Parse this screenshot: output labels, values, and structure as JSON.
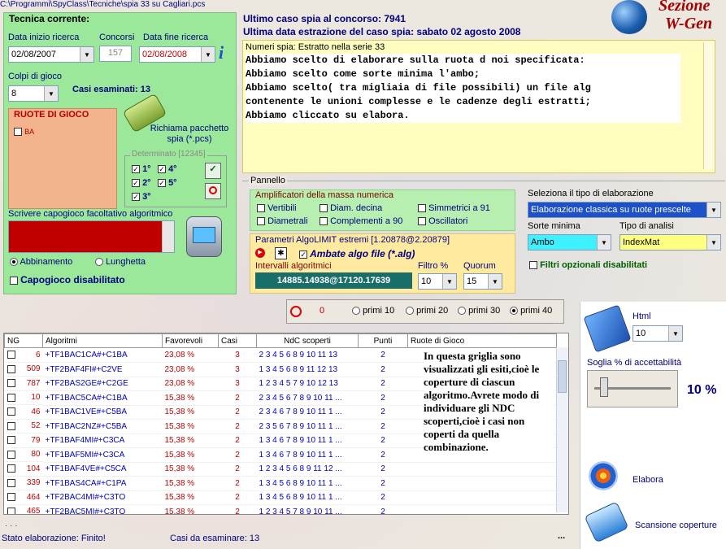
{
  "path": "C:\\Programmi\\SpyClass\\Tecniche\\spia 33 su Cagliari.pcs",
  "brand": {
    "line1": "Sezione",
    "line2": "W-Gen"
  },
  "tecnica": {
    "title": "Tecnica corrente:",
    "data_inizio_label": "Data inizio ricerca",
    "data_inizio_value": "02/08/2007",
    "concorsi_label": "Concorsi",
    "concorsi_value": "157",
    "data_fine_label": "Data fine ricerca",
    "data_fine_value": "02/08/2008",
    "colpi_label": "Colpi di gioco",
    "colpi_value": "8",
    "casi_label": "Casi esaminati: 13",
    "ruote_title": "RUOTE DI GIOCO",
    "ruote_items": [
      "BA"
    ],
    "richiama_label": "Richiama pacchetto spia (*.pcs)",
    "determinato_label": "Determinato [12345]",
    "det": [
      "1°",
      "2°",
      "3°",
      "4°",
      "5°"
    ],
    "capogioco_label": "Scrivere capogioco facoltativo algoritmico",
    "radio_abbinamento": "Abbinamento",
    "radio_lunghetta": "Lunghetta",
    "capogioco_disabled": "Capogioco disabilitato"
  },
  "header_info": {
    "ultimo": "Ultimo caso spia al concorso: 7941",
    "ultima_data": "Ultima data estrazione del caso spia: sabato 02 agosto 2008"
  },
  "notes": {
    "title": "Numeri spia: Estratto nella serie 33",
    "lines": [
      "Abbiamo scelto di elaborare sulla ruota d noi specificata:",
      "Abbiamo scelto come sorte minima l'ambo;",
      "Abbiamo scelto( tra migliaia di file possibili) un file alg",
      "contenente le unioni complesse e le cadenze degli estratti;",
      "Abbiamo cliccato su elabora."
    ]
  },
  "pannello": {
    "title": "Pannello",
    "ampl_title": "Amplificatori della massa numerica",
    "ampl": [
      "Vertibili",
      "Diam. decina",
      "Simmetrici a 91",
      "Diametrali",
      "Complementi a 90",
      "Oscillatori"
    ],
    "param_title": "Parametri AlgoLIMIT estremi [1.20878@2.20879]",
    "ambate_label": "Ambate algo file (*.alg)",
    "intervalli_label": "Intervalli algoritmici",
    "intervalli_value": "14885.14938@17120.17639",
    "filtro_label": "Filtro %",
    "filtro_value": "10",
    "quorum_label": "Quorum",
    "quorum_value": "15",
    "tipo_label": "Seleziona il tipo di elaborazione",
    "tipo_value": "Elaborazione classica su ruote prescelte",
    "sorte_label": "Sorte minima",
    "sorte_value": "Ambo",
    "analisi_label": "Tipo di analisi",
    "analisi_value": "IndexMat",
    "filtri_label": "Filtri opzionali disabilitati"
  },
  "primi": {
    "count": "0",
    "options": [
      "primi 10",
      "primi 20",
      "primi 30",
      "primi 40"
    ],
    "selected": 3
  },
  "grid": {
    "headers": [
      "NG",
      "Algoritmi",
      "Favorevoli",
      "Casi",
      "NdC scoperti",
      "Punti",
      "Ruote di Gioco"
    ],
    "rows": [
      [
        "6",
        "+TF1BAC1CA#+C1BA",
        "23,08 %",
        "3",
        "2 3 4 5 6 8 9 10 11 13",
        "2"
      ],
      [
        "509",
        "+TF2BAF4FI#+C2VE",
        "23,08 %",
        "3",
        "1 3 4 5 6 8 9 11 12 13",
        "2"
      ],
      [
        "787",
        "+TF2BAS2GE#+C2GE",
        "23,08 %",
        "3",
        "1 2 3 4 5 7 9 10 12 13",
        "2"
      ],
      [
        "10",
        "+TF1BAC5CA#+C1BA",
        "15,38 %",
        "2",
        "2 3 4 5 6 7 8 9 10 11 ...",
        "2"
      ],
      [
        "46",
        "+TF1BAC1VE#+C5BA",
        "15,38 %",
        "2",
        "2 3 4 6 7 8 9 10 11 1 ...",
        "2"
      ],
      [
        "52",
        "+TF1BAC2NZ#+C5BA",
        "15,38 %",
        "2",
        "2 3 5 6 7 8 9 10 11 1 ...",
        "2"
      ],
      [
        "79",
        "+TF1BAF4MI#+C3CA",
        "15,38 %",
        "2",
        "1 3 4 6 7 8 9 10 11 1 ...",
        "2"
      ],
      [
        "80",
        "+TF1BAF5MI#+C3CA",
        "15,38 %",
        "2",
        "1 3 4 6 7 8 9 10 11 1 ...",
        "2"
      ],
      [
        "104",
        "+TF1BAF4VE#+C5CA",
        "15,38 %",
        "2",
        "1 2 3 4 5 6 8 9 11 12 ...",
        "2"
      ],
      [
        "339",
        "+TF1BAS4CA#+C1PA",
        "15,38 %",
        "2",
        "1 3 4 5 6 8 9 10 11 1 ...",
        "2"
      ],
      [
        "464",
        "+TF2BAC4MI#+C3TO",
        "15,38 %",
        "2",
        "1 3 4 5 6 8 9 10 11 1 ...",
        "2"
      ],
      [
        "465",
        "+TF2BAC5MI#+C3TO",
        "15,38 %",
        "2",
        "1 2 3 4 5 7 8 9 10 11 ...",
        "2"
      ]
    ],
    "note": "In questa griglia sono visualizzati gli esiti,cioè le coperture di ciascun algoritmo.Avrete modo di individuare gli NDC scoperti,cioè i casi non coperti da quella combinazione."
  },
  "right": {
    "html_label": "Html",
    "html_value": "10",
    "soglia_label": "Soglia % di accettabilità",
    "soglia_value": "10 %",
    "soglia_fraction": 0.1,
    "elabora_label": "Elabora",
    "scansione_label": "Scansione coperture"
  },
  "status": {
    "dots": ". . .",
    "stato": "Stato elaborazione:  Finito!",
    "casi": "Casi da esaminare: 13",
    "ellipsis": "..."
  }
}
